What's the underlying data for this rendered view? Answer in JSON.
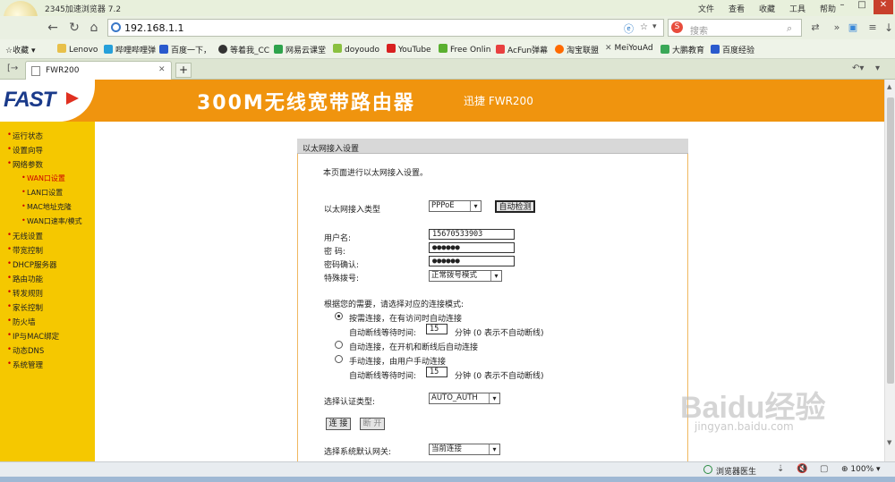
{
  "browser": {
    "title": "2345加速浏览器 7.2",
    "menu": [
      "文件",
      "查看",
      "收藏",
      "工具",
      "帮助"
    ],
    "address": "192.168.1.1",
    "search_placeholder": "搜索",
    "bookmarks": [
      "收藏",
      "Lenovo",
      "哔哩哔哩弹",
      "百度一下，",
      "等着我_CC",
      "网易云课堂",
      "doyoudo",
      "YouTube",
      "Free Onlin",
      "AcFun弹幕",
      "淘宝联盟",
      "MeiYouAd",
      "大鹏教育",
      "百度经验"
    ],
    "tab_label": "FWR200",
    "new_tab": "+",
    "status_doctor": "浏览器医生",
    "zoom": "100%"
  },
  "router": {
    "logo": "FAST",
    "header_title": "300M无线宽带路由器",
    "header_sub": "迅捷 FWR200",
    "sidebar": [
      {
        "label": "运行状态",
        "sub": false,
        "active": false
      },
      {
        "label": "设置向导",
        "sub": false,
        "active": false
      },
      {
        "label": "网络参数",
        "sub": false,
        "active": false
      },
      {
        "label": "WAN口设置",
        "sub": true,
        "active": true
      },
      {
        "label": "LAN口设置",
        "sub": true,
        "active": false
      },
      {
        "label": "MAC地址克隆",
        "sub": true,
        "active": false
      },
      {
        "label": "WAN口速率/模式",
        "sub": true,
        "active": false
      },
      {
        "label": "无线设置",
        "sub": false,
        "active": false
      },
      {
        "label": "带宽控制",
        "sub": false,
        "active": false
      },
      {
        "label": "DHCP服务器",
        "sub": false,
        "active": false
      },
      {
        "label": "路由功能",
        "sub": false,
        "active": false
      },
      {
        "label": "转发规则",
        "sub": false,
        "active": false
      },
      {
        "label": "家长控制",
        "sub": false,
        "active": false
      },
      {
        "label": "防火墙",
        "sub": false,
        "active": false
      },
      {
        "label": "IP与MAC绑定",
        "sub": false,
        "active": false
      },
      {
        "label": "动态DNS",
        "sub": false,
        "active": false
      },
      {
        "label": "系统管理",
        "sub": false,
        "active": false
      }
    ],
    "form": {
      "panel_title": "以太网接入设置",
      "intro": "本页面进行以太网接入设置。",
      "conn_type_label": "以太网接入类型",
      "conn_type_value": "PPPoE",
      "auto_detect": "自动检测",
      "username_label": "用户名:",
      "username_value": "15670533903",
      "password_label": "密 码:",
      "password_value": "●●●●●●",
      "confirm_label": "密码确认:",
      "confirm_value": "●●●●●●",
      "special_dial_label": "特殊拨号:",
      "special_dial_value": "正常拨号模式",
      "mode_prompt": "根据您的需要，请选择对应的连接模式:",
      "opt1": "按需连接，在有访问时自动连接",
      "idle_label": "自动断线等待时间:",
      "idle1_value": "15",
      "idle_unit": "分钟 (0 表示不自动断线)",
      "opt2": "自动连接，在开机和断线后自动连接",
      "opt3": "手动连接，由用户手动连接",
      "idle2_value": "15",
      "auth_label": "选择认证类型:",
      "auth_value": "AUTO_AUTH",
      "connect": "连 接",
      "disconnect": "断 开",
      "gateway_label": "选择系统默认网关:",
      "gateway_value": "当前连接"
    }
  },
  "watermark": {
    "main": "Baidu经验",
    "sub": "jingyan.baidu.com"
  }
}
